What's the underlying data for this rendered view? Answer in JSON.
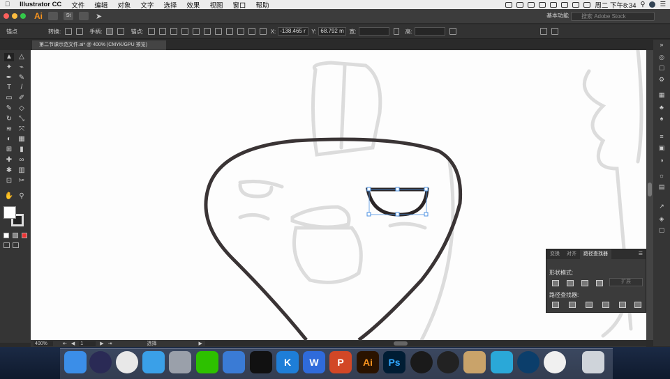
{
  "menubar": {
    "apple": "",
    "app_name": "Illustrator CC",
    "menus": [
      "文件",
      "编辑",
      "对象",
      "文字",
      "选择",
      "效果",
      "视图",
      "窗口",
      "帮助"
    ],
    "clock": "周二 下午8:34"
  },
  "appbar": {
    "logo": "Ai",
    "st_label": "St",
    "workspace_label": "基本功能",
    "stock_placeholder": "搜索 Adobe Stock"
  },
  "control_bar": {
    "anchor_label": "锚点",
    "convert_label": "转换:",
    "handles_label": "手柄:",
    "anchors_label": "锚点:",
    "x_label": "X:",
    "x_value": "-138.465 r",
    "y_label": "Y:",
    "y_value": "68.792 m",
    "width_label": "宽:",
    "height_label": "高:"
  },
  "document_tab": {
    "label": "第二节课示范文件.ai* @ 400% (CMYK/GPU 预览)",
    "close": "×"
  },
  "status_bar": {
    "zoom": "400%",
    "artboard": "1",
    "tool_label": "选择"
  },
  "pathfinder_panel": {
    "tabs": [
      "变换",
      "对齐",
      "路径查找器"
    ],
    "active_tab": "路径查找器",
    "shape_modes_label": "形状模式:",
    "pathfinders_label": "路径查找器:",
    "expand_label": "扩展"
  },
  "toolbar": {
    "tools": [
      "selection-tool",
      "direct-selection-tool",
      "magic-wand-tool",
      "lasso-tool",
      "pen-tool",
      "curvature-tool",
      "type-tool",
      "line-tool",
      "rectangle-tool",
      "paintbrush-tool",
      "shaper-tool",
      "eraser-tool",
      "rotate-tool",
      "scale-tool",
      "width-tool",
      "free-transform-tool",
      "shape-builder-tool",
      "perspective-tool",
      "mesh-tool",
      "gradient-tool",
      "eyedropper-tool",
      "blend-tool",
      "symbol-sprayer-tool",
      "graph-tool",
      "artboard-tool",
      "slice-tool",
      "hand-tool",
      "zoom-tool"
    ]
  },
  "dock": {
    "apps": [
      "finder",
      "siri",
      "chrome",
      "safari",
      "launchpad",
      "wechat",
      "pinyin",
      "qq",
      "kuaibo",
      "wps",
      "powerpoint",
      "illustrator",
      "photoshop",
      "quicktime",
      "obs",
      "archive",
      "pinwheel",
      "cinema4d",
      "itunes",
      "trash"
    ],
    "labels": {
      "illustrator": "Ai",
      "photoshop": "Ps",
      "kuaibo": "K",
      "wps": "W",
      "powerpoint": "P"
    }
  },
  "colors": {
    "accent_ai": "#f7931e",
    "selection_blue": "#4a90e2",
    "stroke_dark": "#3a3435"
  }
}
